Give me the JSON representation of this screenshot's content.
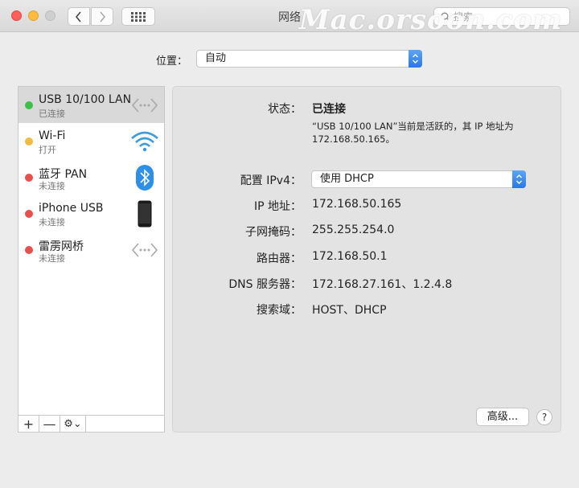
{
  "window": {
    "title": "网络",
    "watermark": "Mac.orsoon.com",
    "search_placeholder": "搜索"
  },
  "location": {
    "label": "位置：",
    "value": "自动"
  },
  "services": [
    {
      "name": "USB 10/100 LAN",
      "status": "已连接",
      "dot": "#3cc04a",
      "icon": "ethernet-icon"
    },
    {
      "name": "Wi-Fi",
      "status": "打开",
      "dot": "#f2bc41",
      "icon": "wifi-icon"
    },
    {
      "name": "蓝牙 PAN",
      "status": "未连接",
      "dot": "#e9504b",
      "icon": "bluetooth-icon"
    },
    {
      "name": "iPhone USB",
      "status": "未连接",
      "dot": "#e9504b",
      "icon": "iphone-icon"
    },
    {
      "name": "雷雳网桥",
      "status": "未连接",
      "dot": "#e9504b",
      "icon": "thunderbolt-bridge-icon"
    }
  ],
  "sidebar_buttons": {
    "add": "+",
    "remove": "—",
    "gear": "⚙⌄"
  },
  "detail": {
    "status_label": "状态：",
    "status_value": "已连接",
    "status_desc_line1": "“USB 10/100 LAN”当前是活跃的，其 IP 地址为",
    "status_desc_line2": "172.168.50.165。",
    "config_label": "配置 IPv4：",
    "config_value": "使用 DHCP",
    "ip_label": "IP 地址：",
    "ip_value": "172.168.50.165",
    "subnet_label": "子网掩码：",
    "subnet_value": "255.255.254.0",
    "router_label": "路由器：",
    "router_value": "172.168.50.1",
    "dns_label": "DNS 服务器：",
    "dns_value": "172.168.27.161、1.2.4.8",
    "search_domain_label": "搜索域：",
    "search_domain_value": "HOST、DHCP",
    "advanced_button": "高级...",
    "help_button": "?"
  }
}
